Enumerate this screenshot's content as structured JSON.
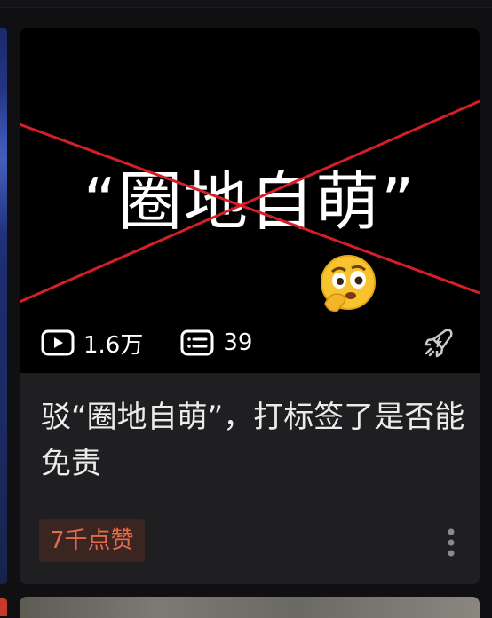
{
  "card": {
    "thumbnail_text": "“圈地自萌”",
    "views": "1.6万",
    "comments": "39",
    "title": "驳“圈地自萌”，打标签了是否能免责",
    "likes_badge": "7千点赞"
  },
  "icons": {
    "views": "play-icon",
    "comments": "danmaku-list-icon",
    "boost": "rocket-icon",
    "more": "more-vertical-icon",
    "emoji": "thinking-face-emoji"
  },
  "colors": {
    "cross_line": "#d41f28",
    "badge_text": "#e06b4d",
    "badge_bg": "#3b2521",
    "card_bg": "#1f1f22"
  }
}
